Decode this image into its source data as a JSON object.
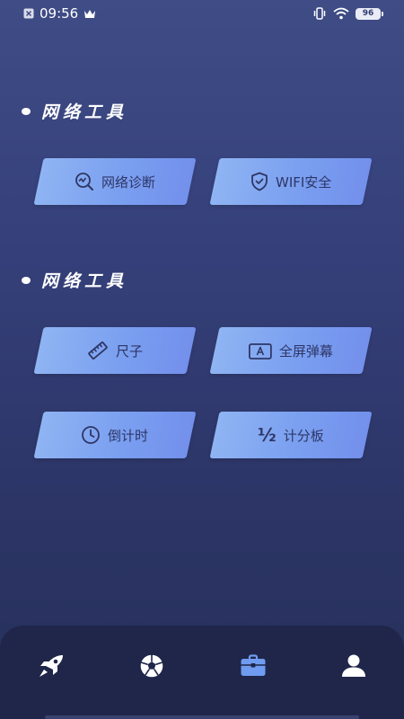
{
  "status_bar": {
    "time": "09:56",
    "battery": "96"
  },
  "sections": [
    {
      "title": "网络工具"
    },
    {
      "title": "网络工具"
    }
  ],
  "tools": {
    "net_diagnose": {
      "label": "网络诊断",
      "icon": "search-chart-icon"
    },
    "wifi_security": {
      "label": "WIFI安全",
      "icon": "shield-check-icon"
    },
    "ruler": {
      "label": "尺子",
      "icon": "ruler-icon"
    },
    "fullscreen_danmaku": {
      "label": "全屏弹幕",
      "icon": "text-box-icon"
    },
    "countdown": {
      "label": "倒计时",
      "icon": "clock-icon"
    },
    "scoreboard": {
      "label": "计分板",
      "icon": "half-fraction-icon",
      "icon_text": "½"
    }
  },
  "bottom_nav": {
    "items": [
      {
        "name": "rocket",
        "icon": "rocket-icon"
      },
      {
        "name": "ball",
        "icon": "soccer-ball-icon"
      },
      {
        "name": "tools",
        "icon": "briefcase-icon",
        "active": true
      },
      {
        "name": "profile",
        "icon": "user-icon"
      }
    ]
  },
  "colors": {
    "background_top": "#3f4c86",
    "background_bottom": "#26305a",
    "button_light": "#8fb4f3",
    "button_dark": "#7390ec",
    "button_text": "#2e3666",
    "nav_bg": "#1f2649",
    "active_icon": "#6f9cf0"
  }
}
